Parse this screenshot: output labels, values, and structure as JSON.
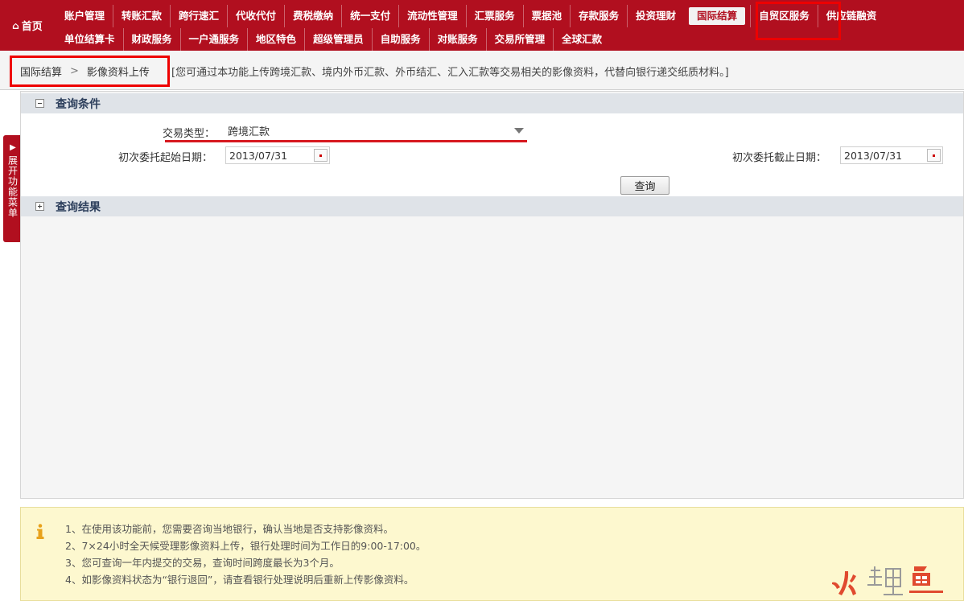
{
  "nav": {
    "home_label": "首页",
    "row1": [
      "账户管理",
      "转账汇款",
      "跨行速汇",
      "代收代付",
      "费税缴纳",
      "统一支付",
      "流动性管理",
      "汇票服务",
      "票据池",
      "存款服务",
      "投资理财",
      "国际结算",
      "自贸区服务",
      "供应链融资"
    ],
    "row2": [
      "单位结算卡",
      "财政服务",
      "一户通服务",
      "地区特色",
      "超级管理员",
      "自助服务",
      "对账服务",
      "交易所管理",
      "全球汇款"
    ],
    "active_item": "国际结算"
  },
  "breadcrumb": {
    "section": "国际结算",
    "separator": ">",
    "page": "影像资料上传",
    "description": "[您可通过本功能上传跨境汇款、境内外币汇款、外币结汇、汇入汇款等交易相关的影像资料，代替向银行递交纸质材料。]"
  },
  "side_tab": {
    "label": "展开功能菜单"
  },
  "query": {
    "title": "查询条件",
    "txn_type_label": "交易类型：",
    "txn_type_value": "跨境汇款",
    "start_date_label": "初次委托起始日期：",
    "start_date_value": "2013/07/31",
    "end_date_label": "初次委托截止日期：",
    "end_date_value": "2013/07/31",
    "button_label": "查询"
  },
  "results": {
    "title": "查询结果"
  },
  "notice": {
    "items": [
      "1、在使用该功能前，您需要咨询当地银行，确认当地是否支持影像资料。",
      "2、7×24小时全天候受理影像资料上传，银行处理时间为工作日的9:00-17:00。",
      "3、您可查询一年内提交的交易，查询时间跨度最长为3个月。",
      "4、如影像资料状态为“银行退回”，请查看银行处理说明后重新上传影像资料。"
    ]
  },
  "watermark": {
    "text": "鲤鱼"
  },
  "colors": {
    "brand_red": "#b10f1f",
    "highlight_red": "#e00000",
    "notice_bg": "#fdf8cf",
    "section_head_bg": "#dfe3e8"
  },
  "icons": {
    "home": "home-icon",
    "info": "info-icon",
    "calendar": "calendar-icon",
    "dropdown": "chevron-down-icon",
    "expand": "plus-icon",
    "collapse": "minus-icon",
    "side_arrow": "arrow-right-icon"
  }
}
